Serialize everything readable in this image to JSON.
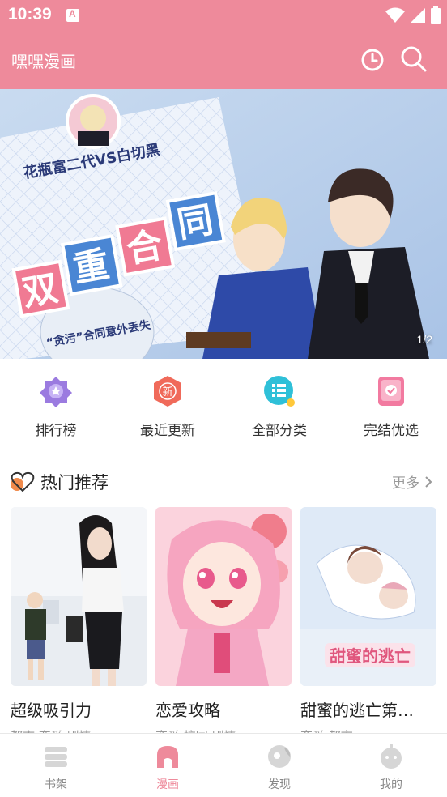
{
  "status_bar": {
    "time": "10:39"
  },
  "app_bar": {
    "title": "嘿嘿漫画",
    "history_icon": "clock-icon",
    "search_icon": "search-icon"
  },
  "banner": {
    "indicator": "1/2",
    "artwork_text": {
      "tagline": "花瓶富二代VS白切黑",
      "title": "双重合同",
      "subtitle": "“贪污”合同意外丢失\n引发的一场别开生面的意外!"
    }
  },
  "quick_nav": [
    {
      "label": "排行榜",
      "icon": "ranking-medal-icon",
      "color": "#9b7be0"
    },
    {
      "label": "最近更新",
      "icon": "new-badge-icon",
      "color": "#f06a5a"
    },
    {
      "label": "全部分类",
      "icon": "category-list-icon",
      "color": "#2fc0d8"
    },
    {
      "label": "完结优选",
      "icon": "finished-book-icon",
      "color": "#f27aa0"
    }
  ],
  "hot_section": {
    "title": "热门推荐",
    "more_label": "更多"
  },
  "comics": [
    {
      "title": "超级吸引力",
      "subtitle": "都市 恋爱 剧情"
    },
    {
      "title": "恋爱攻略",
      "subtitle": "恋爱 校园 剧情"
    },
    {
      "title": "甜蜜的逃亡第…",
      "subtitle": "恋爱 都市",
      "cover_text": "甜蜜的逃亡"
    }
  ],
  "bottom_nav": [
    {
      "label": "书架",
      "icon": "bookshelf-icon",
      "active": false
    },
    {
      "label": "漫画",
      "icon": "comic-icon",
      "active": true
    },
    {
      "label": "发现",
      "icon": "discover-icon",
      "active": false
    },
    {
      "label": "我的",
      "icon": "profile-icon",
      "active": false
    }
  ],
  "colors": {
    "accent": "#ee8a9b",
    "text": "#222222",
    "muted": "#999999"
  }
}
